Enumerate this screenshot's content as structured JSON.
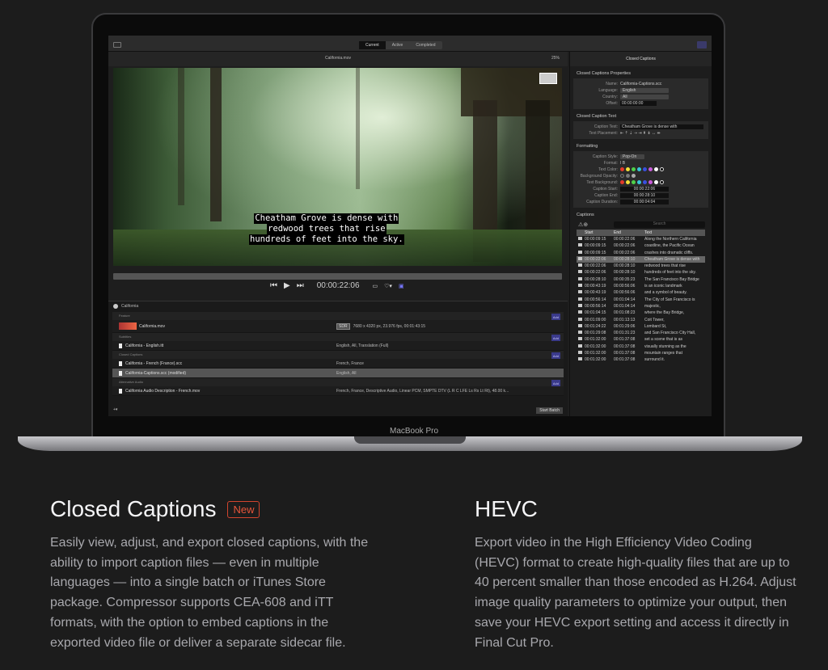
{
  "device_label": "MacBook Pro",
  "app": {
    "tabs": [
      "Current",
      "Active",
      "Completed"
    ],
    "file_title": "California.mov",
    "zoom": "25%",
    "caption_lines": [
      "Cheatham Grove is dense with",
      "redwood trees that rise",
      "hundreds of feet into the sky."
    ],
    "timecode": "00:00:22:06",
    "batch": {
      "title": "California",
      "add_label": "Add",
      "sections": [
        {
          "name": "Feature",
          "items": [
            {
              "name": "California.mov",
              "badge": "SDR",
              "info": "7680 x 4320 px, 23.976 fps, 00:01:43:15"
            }
          ]
        },
        {
          "name": "Subtitles",
          "items": [
            {
              "name": "California - English.itt",
              "info": "English, All, Translation (Full)"
            }
          ]
        },
        {
          "name": "Closed Captions",
          "items": [
            {
              "name": "California - French (France).scc",
              "info": "French, France"
            },
            {
              "name": "California-Captions.scc (modified)",
              "info": "English, All",
              "selected": true
            }
          ]
        },
        {
          "name": "Alternative Audio",
          "items": [
            {
              "name": "California Audio Description - French.mov",
              "info": "French, France, Descriptive Audio, Linear PCM, SMPTE DTV (L R C LFE Ls Rs Lt Rt), 48.00 k..."
            }
          ]
        }
      ],
      "start_batch": "Start Batch"
    },
    "inspector": {
      "title": "Closed Captions",
      "props_title": "Closed Captions Properties",
      "name_label": "Name:",
      "name": "California-Captions.scc",
      "language_label": "Language:",
      "language": "English",
      "country_label": "Country:",
      "country": "All",
      "offset_label": "Offset:",
      "offset": "00:00:00:00",
      "text_title": "Closed Caption Text",
      "caption_text_label": "Caption Text:",
      "caption_text": "Cheatham Grove is dense with",
      "placement_label": "Text Placement:",
      "placement_icons": "⇤ ⇡ ⇣ ⇢ ⇥ ⇞ ⇟ ↔ ⇹",
      "formatting_title": "Formatting",
      "style_label": "Caption Style:",
      "style": "Pop-On",
      "format_label": "Format:",
      "format": "I  B",
      "text_color_label": "Text Color:",
      "bg_opacity_label": "Background Opacity:",
      "text_bg_label": "Text Background:",
      "colors": [
        "#e23b2a",
        "#f3e23a",
        "#4fd04a",
        "#37c7d8",
        "#3a4fe0",
        "#c75ad8",
        "#ffffff",
        "#000000"
      ],
      "start_label": "Caption Start:",
      "start": "00:00:22:06",
      "end_label": "Caption End:",
      "end": "00:00:28:10",
      "duration_label": "Caption Duration:",
      "duration": "00:00:04:04",
      "captions_title": "Captions",
      "search_placeholder": "Search",
      "columns": [
        "Start",
        "End",
        "Text"
      ],
      "rows": [
        [
          "00:00:09:15",
          "00:00:22:06",
          "Along the Northern California"
        ],
        [
          "00:00:09:15",
          "00:00:22:06",
          "coastline, the Pacific Ocean"
        ],
        [
          "00:00:09:15",
          "00:00:22:06",
          "crashes into dramatic cliffs."
        ],
        [
          "00:00:22:06",
          "00:00:28:10",
          "Cheatham Grove is dense with"
        ],
        [
          "00:00:22:06",
          "00:00:28:10",
          "redwood trees that rise"
        ],
        [
          "00:00:22:06",
          "00:00:28:10",
          "hundreds of feet into the sky."
        ],
        [
          "00:00:28:10",
          "00:00:35:23",
          "The San Francisco Bay Bridge"
        ],
        [
          "00:00:43:19",
          "00:00:56:06",
          "is an iconic landmark"
        ],
        [
          "00:00:43:19",
          "00:00:56:06",
          "and a symbol of beauty."
        ],
        [
          "00:00:56:14",
          "00:01:04:14",
          "The City of San Francisco is"
        ],
        [
          "00:00:56:14",
          "00:01:04:14",
          "majestic,"
        ],
        [
          "00:01:04:15",
          "00:01:08:23",
          "where the Bay Bridge,"
        ],
        [
          "00:01:09:00",
          "00:01:13:13",
          "Coit Tower,"
        ],
        [
          "00:01:24:22",
          "00:01:29:06",
          "Lombard St,"
        ],
        [
          "00:01:29:08",
          "00:01:31:23",
          "and San Francisco City Hall,"
        ],
        [
          "00:01:32:00",
          "00:01:37:08",
          "set a scene that is as"
        ],
        [
          "00:01:32:00",
          "00:01:37:08",
          "visually stunning as the"
        ],
        [
          "00:01:32:00",
          "00:01:37:08",
          "mountain ranges that"
        ],
        [
          "00:01:32:00",
          "00:01:37:08",
          "surround it."
        ]
      ],
      "selected_row": 3
    }
  },
  "features": [
    {
      "title": "Closed Captions",
      "badge": "New",
      "text": "Easily view, adjust, and export closed captions, with the ability to import caption files — even in multiple languages — into a single batch or iTunes Store package. Compressor supports CEA-608 and iTT formats, with the option to embed captions in the exported video file or deliver a separate sidecar file."
    },
    {
      "title": "HEVC",
      "text": "Export video in the High Efficiency Video Coding (HEVC) format to create high-quality files that are up to 40 percent smaller than those encoded as H.264. Adjust image quality parameters to optimize your output, then save your HEVC export setting and access it directly in Final Cut Pro."
    }
  ]
}
